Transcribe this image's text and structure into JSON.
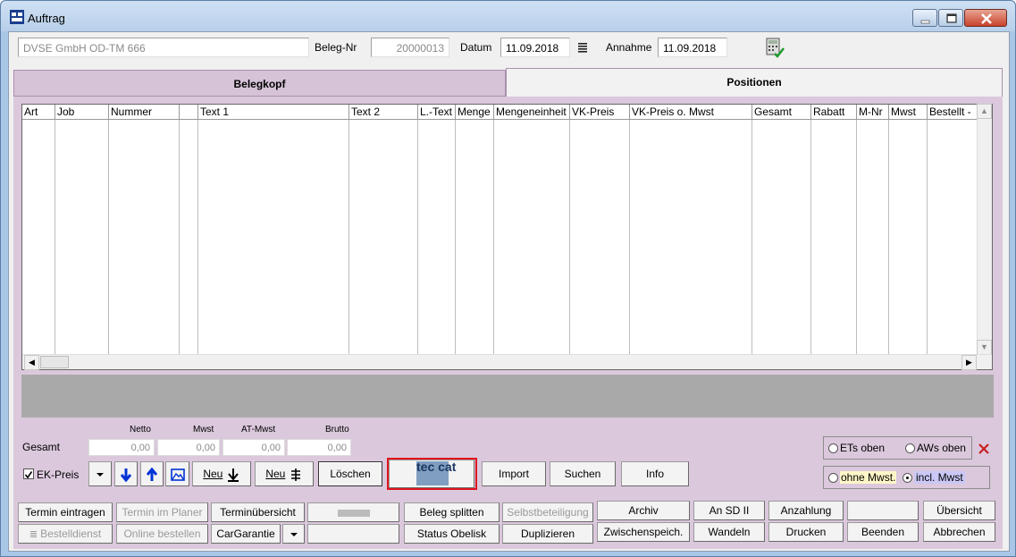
{
  "window": {
    "title": "Auftrag"
  },
  "header": {
    "customer": "DVSE GmbH OD-TM 666",
    "beleg_label": "Beleg-Nr",
    "beleg_value": "20000013",
    "datum_label": "Datum",
    "datum_value": "11.09.2018",
    "annahme_label": "Annahme",
    "annahme_value": "11.09.2018"
  },
  "tabs": {
    "belegkopf": "Belegkopf",
    "positionen": "Positionen"
  },
  "grid": {
    "columns": [
      "Art",
      "Job",
      "Nummer",
      "",
      "Text 1",
      "Text 2",
      "L.-Text",
      "Menge",
      "Mengeneinheit",
      "VK-Preis",
      "VK-Preis o. Mwst",
      "Gesamt",
      "Rabatt",
      "M-Nr",
      "Mwst",
      "Bestellt -"
    ]
  },
  "totals": {
    "label": "Gesamt",
    "headers": {
      "netto": "Netto",
      "mwst": "Mwst",
      "atmwst": "AT-Mwst",
      "brutto": "Brutto"
    },
    "values": {
      "netto": "0,00",
      "mwst": "0,00",
      "atmwst": "0,00",
      "brutto": "0,00"
    }
  },
  "toolbar": {
    "ek_preis": "EK-Preis",
    "neu1": "Neu",
    "neu2": "Neu",
    "loeschen": "Löschen",
    "tecdoc_logo": "tec cat",
    "import": "Import",
    "suchen": "Suchen",
    "info": "Info"
  },
  "options": {
    "ets_oben": "ETs oben",
    "aws_oben": "AWs oben",
    "ohne_mwst": "ohne Mwst.",
    "incl_mwst": "incl. Mwst",
    "selected": "incl_mwst"
  },
  "bottom": {
    "row1": {
      "termin_eintragen": "Termin eintragen",
      "termin_planer": "Termin im Planer",
      "terminuebersicht": "Terminübersicht",
      "beleg_splitten": "Beleg splitten",
      "selbstbeteiligung": "Selbstbeteiligung",
      "archiv": "Archiv",
      "an_sd": "An SD II",
      "anzahlung": "Anzahlung",
      "uebersicht": "Übersicht"
    },
    "row2": {
      "bestelldienst": "Bestelldienst",
      "online_bestellen": "Online bestellen",
      "cargarantie": "CarGarantie",
      "status_obelisk": "Status Obelisk",
      "duplizieren": "Duplizieren",
      "zwischenspeich": "Zwischenspeich.",
      "wandeln": "Wandeln",
      "drucken": "Drucken",
      "beenden": "Beenden",
      "abbrechen": "Abbrechen"
    }
  },
  "colors": {
    "panel": "#dbc8dc",
    "highlight": "#e0141e",
    "title_bar": "#b7d0ea"
  }
}
